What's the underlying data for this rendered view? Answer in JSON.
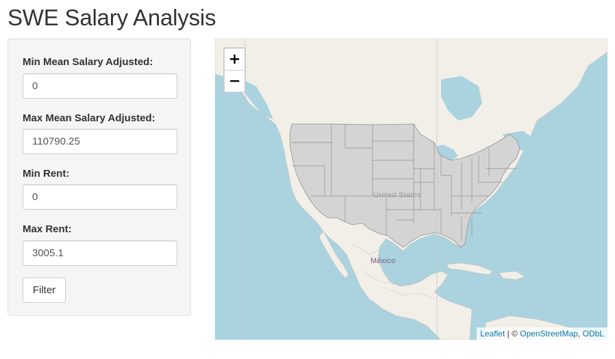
{
  "page": {
    "title": "SWE Salary Analysis"
  },
  "filters": {
    "min_salary": {
      "label": "Min Mean Salary Adjusted:",
      "value": "0"
    },
    "max_salary": {
      "label": "Max Mean Salary Adjusted:",
      "value": "110790.25"
    },
    "min_rent": {
      "label": "Min Rent:",
      "value": "0"
    },
    "max_rent": {
      "label": "Max Rent:",
      "value": "3005.1"
    },
    "filter_button": "Filter"
  },
  "map": {
    "zoom_in": "+",
    "zoom_out": "−",
    "labels": {
      "united_states": "United States",
      "mexico": "México"
    },
    "attribution": {
      "leaflet": "Leaflet",
      "separator": " | © ",
      "osm": "OpenStreetMap",
      "comma": ", ",
      "odbl": "ODbL"
    },
    "colors": {
      "water": "#aad3df",
      "land": "#f2efe9",
      "state_fill": "#d4d4d4",
      "state_stroke": "#8f8f8f"
    }
  }
}
